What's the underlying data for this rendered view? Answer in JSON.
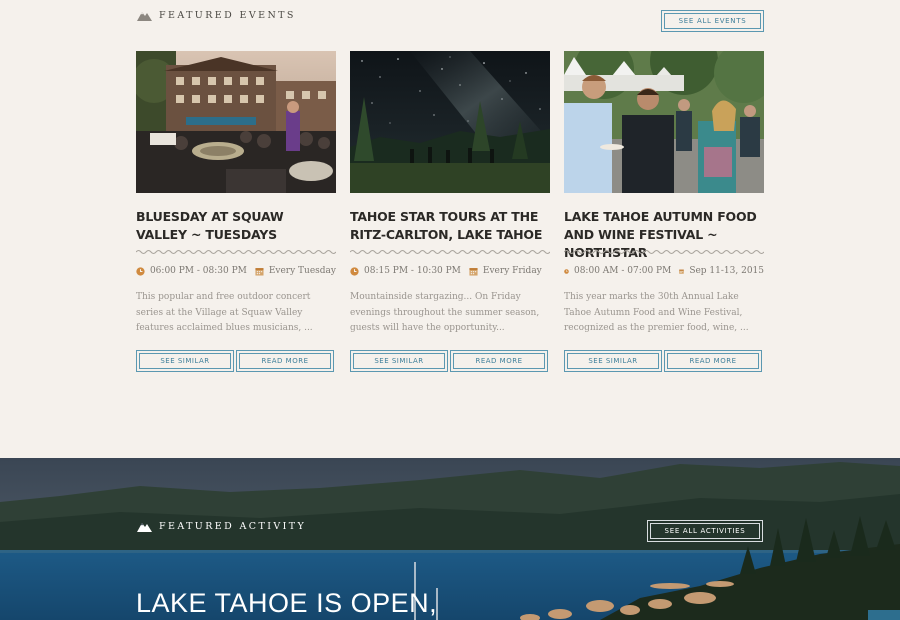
{
  "featured_events": {
    "heading": "Featured Events",
    "see_all_label": "See All Events",
    "cards": [
      {
        "title": "Bluesday at Squaw Valley ~ Tuesdays",
        "time": "06:00 PM - 08:30 PM",
        "date": "Every Tuesday",
        "description": "This popular and free outdoor concert series at the Village at Squaw Valley features acclaimed blues musicians, ...",
        "see_similar_label": "See Similar",
        "read_more_label": "Read More"
      },
      {
        "title": "Tahoe Star Tours at the Ritz-Carlton, Lake Tahoe",
        "time": "08:15 PM - 10:30 PM",
        "date": "Every Friday",
        "description": "Mountainside stargazing... On Friday evenings throughout the summer season, guests will have the opportunity...",
        "see_similar_label": "See Similar",
        "read_more_label": "Read More"
      },
      {
        "title": "Lake Tahoe Autumn Food and Wine Festival ~ Northstar",
        "time": "08:00 AM - 07:00 PM",
        "date": "Sep 11-13, 2015",
        "description": "This year marks the 30th Annual Lake Tahoe Autumn Food and Wine Festival, recognized as the premier food, wine, ...",
        "see_similar_label": "See Similar",
        "read_more_label": "Read More"
      }
    ]
  },
  "featured_activity": {
    "heading": "Featured Activity",
    "see_all_label": "See All Activities",
    "hero_title": "Lake Tahoe is Open,"
  },
  "icons": {
    "section": "mountain-icon",
    "time": "clock-icon",
    "date": "calendar-icon"
  },
  "colors": {
    "background": "#f5f1ec",
    "accent_button": "#3e7f9a",
    "icon_orange": "#d08a3f",
    "heading_dark": "#2b2926",
    "body_text": "#9a958f"
  }
}
